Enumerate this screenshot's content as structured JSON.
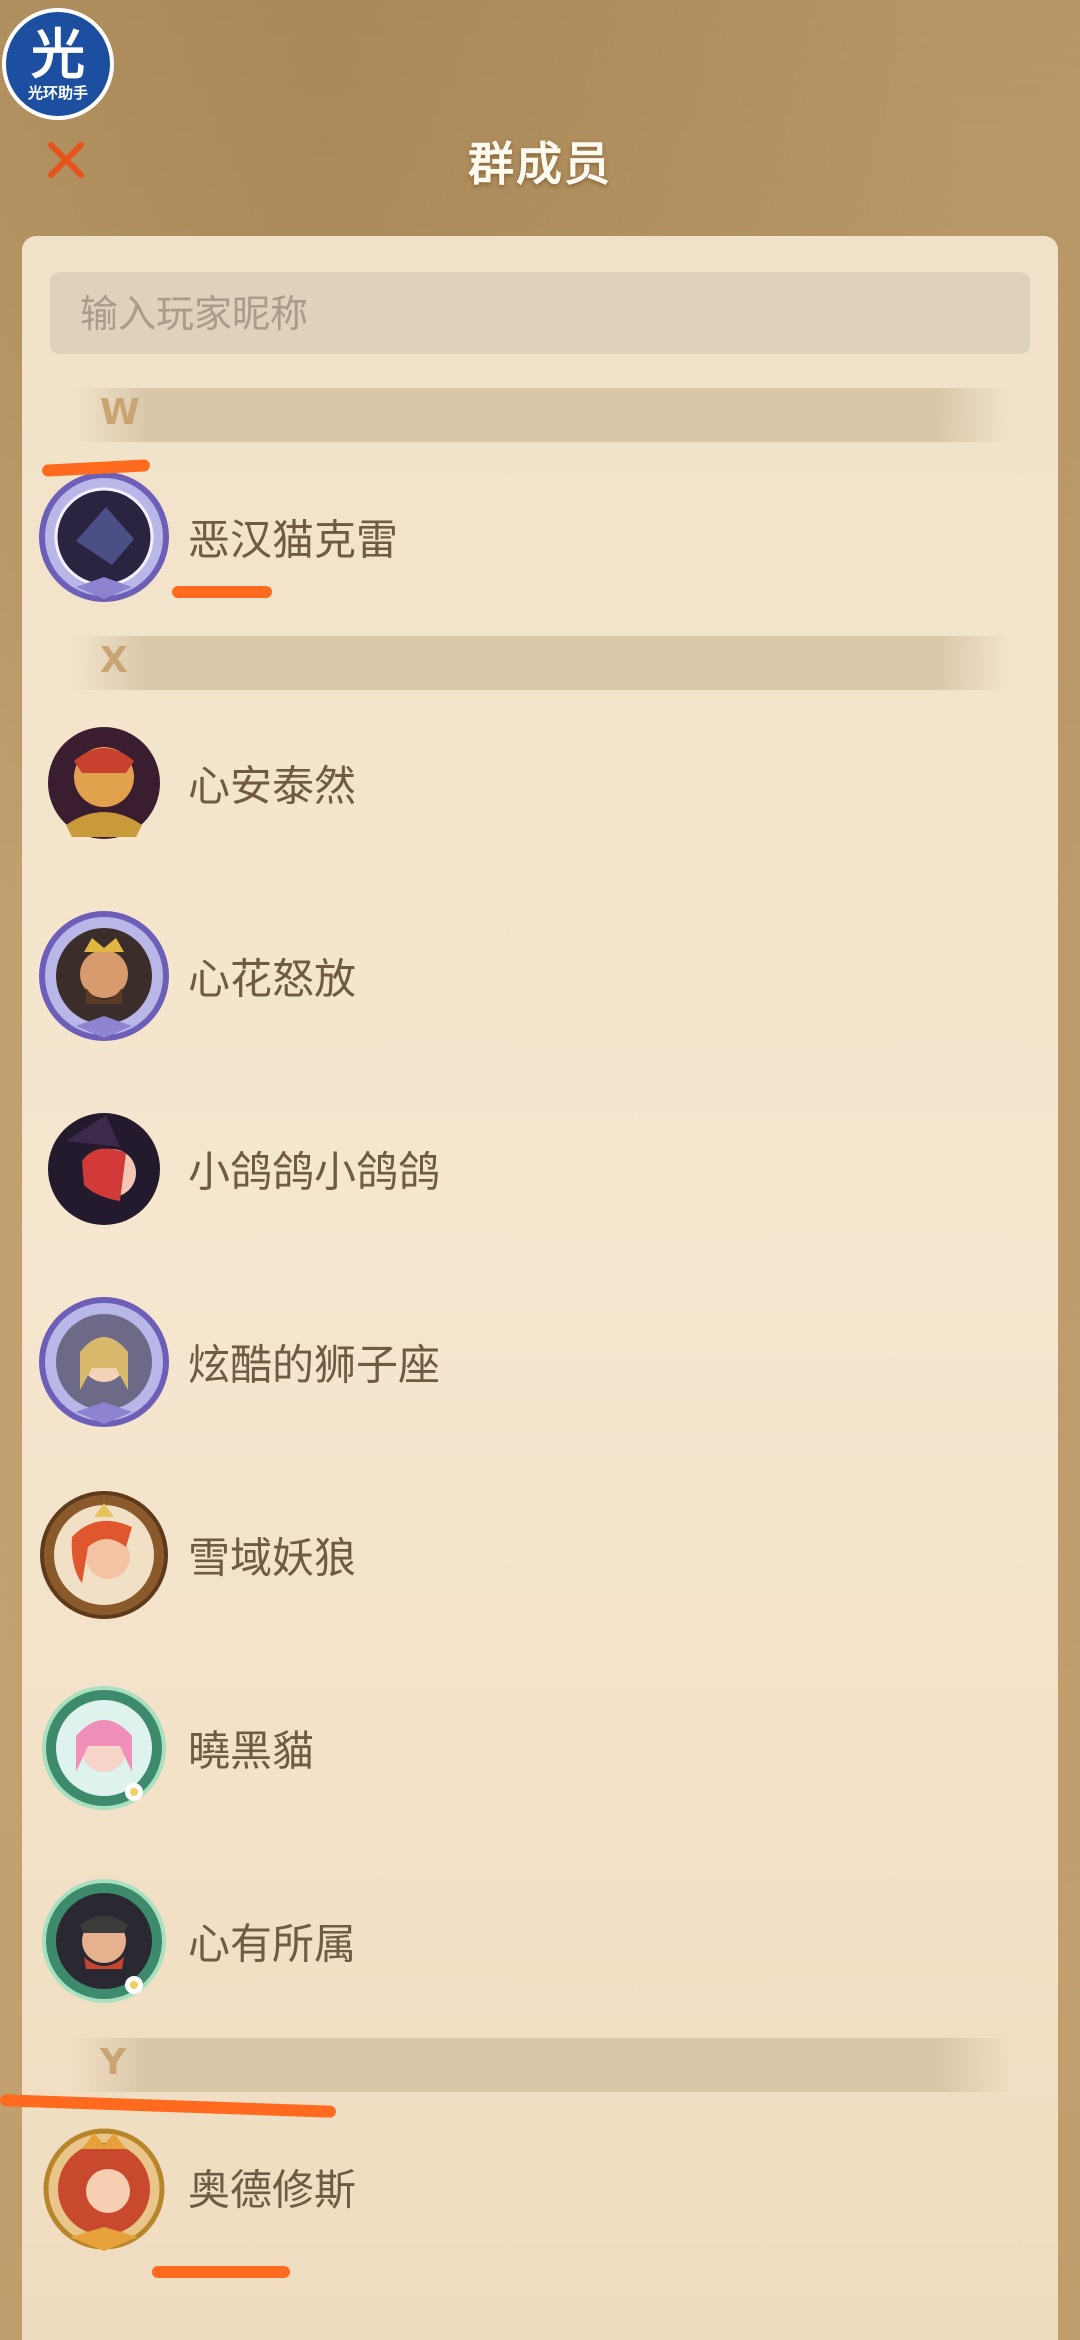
{
  "badge": {
    "char": "光",
    "label": "光环助手"
  },
  "header": {
    "title": "群成员"
  },
  "search": {
    "placeholder": "输入玩家昵称",
    "value": ""
  },
  "sections": [
    {
      "letter": "W",
      "members": [
        {
          "name": "恶汉猫克雷",
          "frame": "silver"
        }
      ]
    },
    {
      "letter": "X",
      "members": [
        {
          "name": "心安泰然",
          "frame": "plain"
        },
        {
          "name": "心花怒放",
          "frame": "silver"
        },
        {
          "name": "小鸽鸽小鸽鸽",
          "frame": "plain"
        },
        {
          "name": "炫酷的狮子座",
          "frame": "silver"
        },
        {
          "name": "雪域妖狼",
          "frame": "bronze"
        },
        {
          "name": "曉黑貓",
          "frame": "floral"
        },
        {
          "name": "心有所属",
          "frame": "floral"
        }
      ]
    },
    {
      "letter": "Y",
      "members": [
        {
          "name": "奥德修斯",
          "frame": "gold"
        }
      ]
    }
  ],
  "colors": {
    "accent": "#ff6a1f",
    "title_text": "#fffaf0",
    "name_text": "#6f5a43",
    "section_letter": "#c8a572"
  }
}
